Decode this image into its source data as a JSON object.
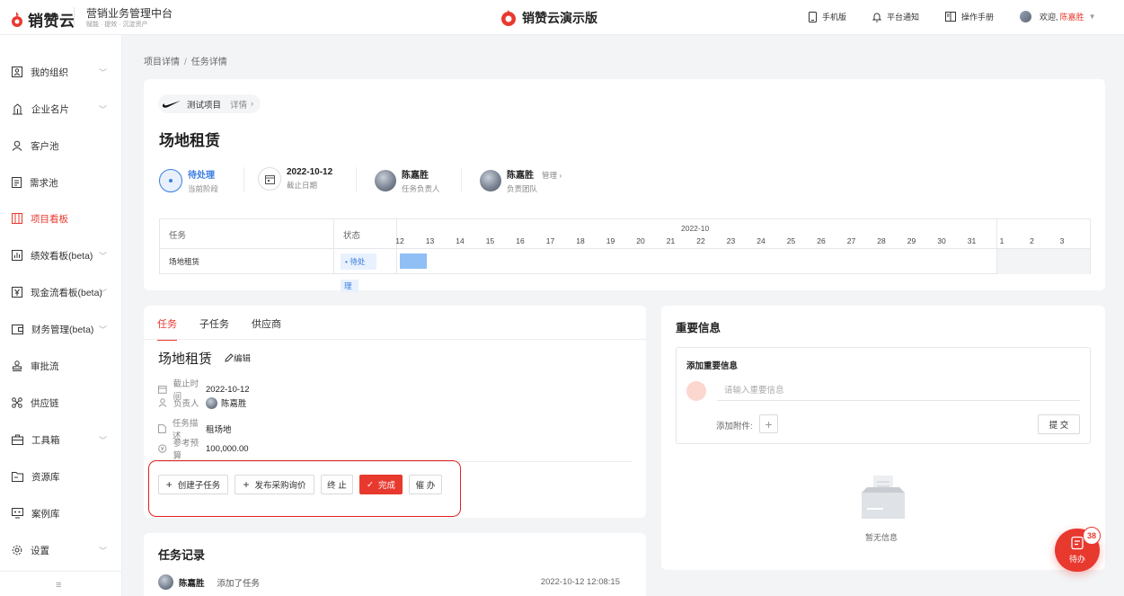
{
  "header": {
    "brand": "销赞云",
    "platform_title": "营销业务管理中台",
    "platform_sub": "赋能 · 提效 · 沉淀资产",
    "center_title": "销赞云演示版",
    "actions": [
      {
        "label": "手机版",
        "icon": "mobile-icon"
      },
      {
        "label": "平台通知",
        "icon": "bell-icon"
      },
      {
        "label": "操作手册",
        "icon": "book-icon"
      }
    ],
    "welcome": "欢迎,",
    "user_name": "陈嘉胜"
  },
  "sidebar": {
    "items": [
      {
        "label": "我的组织",
        "icon": "org-icon",
        "has_children": true
      },
      {
        "label": "企业名片",
        "icon": "building-icon",
        "has_children": true
      },
      {
        "label": "客户池",
        "icon": "user-icon",
        "has_children": false
      },
      {
        "label": "需求池",
        "icon": "clipboard-icon",
        "has_children": false
      },
      {
        "label": "项目看板",
        "icon": "kanban-icon",
        "has_children": false,
        "active": true
      },
      {
        "label": "绩效看板(beta)",
        "icon": "chart-icon",
        "has_children": true
      },
      {
        "label": "现金流看板(beta)",
        "icon": "yen-icon",
        "has_children": true
      },
      {
        "label": "财务管理(beta)",
        "icon": "wallet-icon",
        "has_children": true
      },
      {
        "label": "审批流",
        "icon": "stamp-icon",
        "has_children": false
      },
      {
        "label": "供应链",
        "icon": "network-icon",
        "has_children": false
      },
      {
        "label": "工具箱",
        "icon": "toolbox-icon",
        "has_children": true
      },
      {
        "label": "资源库",
        "icon": "folder-icon",
        "has_children": false
      },
      {
        "label": "案例库",
        "icon": "monitor-icon",
        "has_children": false
      },
      {
        "label": "设置",
        "icon": "gear-icon",
        "has_children": true
      }
    ],
    "collapse_icon": "≡"
  },
  "breadcrumb": {
    "items": [
      "项目详情",
      "任务详情"
    ],
    "separator": "/"
  },
  "project": {
    "tag_name": "测试项目",
    "tag_detail": "详情",
    "task_title": "场地租赁",
    "meta": [
      {
        "value": "待处理",
        "label": "当前阶段"
      },
      {
        "value": "2022-10-12",
        "label": "截止日期"
      },
      {
        "value": "陈嘉胜",
        "label": "任务负责人"
      },
      {
        "value": "陈嘉胜",
        "label": "负责团队",
        "link": "管理"
      }
    ]
  },
  "gantt": {
    "col_task": "任务",
    "col_status": "状态",
    "month": "2022-10",
    "days": [
      "12",
      "13",
      "14",
      "15",
      "16",
      "17",
      "18",
      "19",
      "20",
      "21",
      "22",
      "23",
      "24",
      "25",
      "26",
      "27",
      "28",
      "29",
      "30",
      "31",
      "1",
      "2",
      "3"
    ],
    "rows": [
      {
        "task": "场地租赁",
        "status_line1": "• 待处",
        "status_line2": "理",
        "start": "2022-10-12",
        "end": "2022-10-12"
      }
    ]
  },
  "detail": {
    "tabs": [
      "任务",
      "子任务",
      "供应商"
    ],
    "active_tab": "任务",
    "title": "场地租赁",
    "edit_label": "编辑",
    "fields": [
      {
        "label": "截止时间",
        "value": "2022-10-12",
        "icon": "calendar-icon"
      },
      {
        "label": "负责人",
        "value": "陈嘉胜",
        "icon": "person-icon"
      },
      {
        "label": "任务描述",
        "value": "租场地",
        "icon": "doc-icon"
      },
      {
        "label": "参考预算",
        "value": "100,000.00",
        "icon": "coin-icon"
      }
    ],
    "buttons": {
      "create_subtask": "创建子任务",
      "publish_rfq": "发布采购询价",
      "terminate": "终 止",
      "complete": "完成",
      "urge": "催 办"
    }
  },
  "records": {
    "title": "任务记录",
    "items": [
      {
        "name": "陈嘉胜",
        "action": "添加了任务",
        "time": "2022-10-12 12:08:15"
      }
    ]
  },
  "info": {
    "title": "重要信息",
    "box_title": "添加重要信息",
    "input_placeholder": "请输入重要信息",
    "attach_label": "添加附件:",
    "submit_label": "提 交",
    "empty_text": "暂无信息"
  },
  "todo": {
    "label": "待办",
    "count": "38"
  },
  "colors": {
    "accent": "#e8392f",
    "status_blue": "#3a7de0",
    "gantt_bar": "#8fbff5"
  }
}
